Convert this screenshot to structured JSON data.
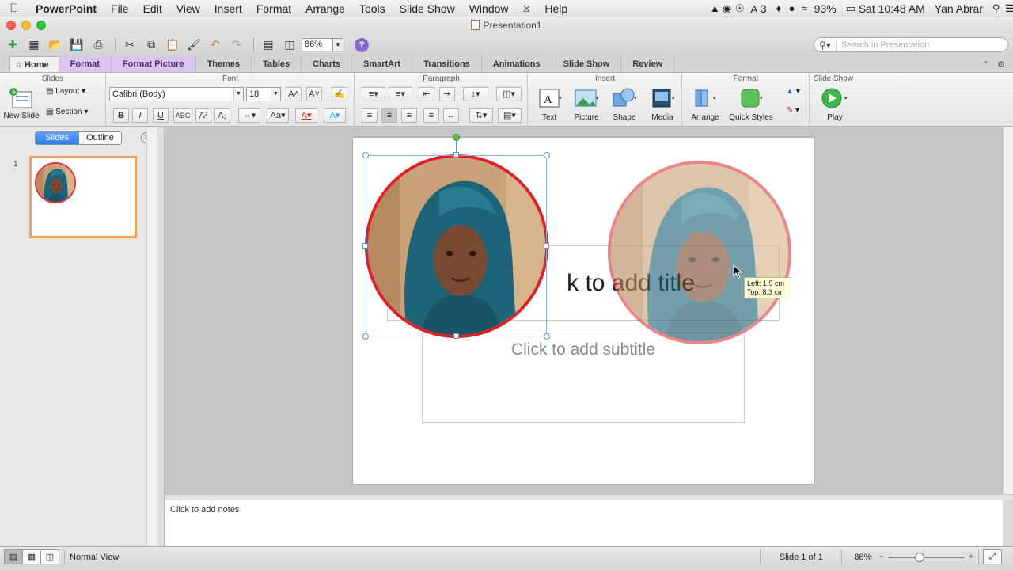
{
  "menubar": {
    "app_name": "PowerPoint",
    "items": [
      "File",
      "Edit",
      "View",
      "Insert",
      "Format",
      "Arrange",
      "Tools",
      "Slide Show",
      "Window",
      "Help"
    ],
    "status": {
      "notif_count": "3",
      "battery": "93%",
      "clock": "Sat 10:48 AM",
      "user": "Yan Abrar"
    }
  },
  "window": {
    "title": "Presentation1"
  },
  "toolbar": {
    "zoom": "86%",
    "search_placeholder": "Search in Presentation"
  },
  "ribbon_tabs": [
    "Home",
    "Format",
    "Format Picture",
    "Themes",
    "Tables",
    "Charts",
    "SmartArt",
    "Transitions",
    "Animations",
    "Slide Show",
    "Review"
  ],
  "ribbon": {
    "groups": {
      "slides": "Slides",
      "font": "Font",
      "paragraph": "Paragraph",
      "insert": "Insert",
      "format": "Format",
      "slideshow": "Slide Show"
    },
    "new_slide": "New Slide",
    "layout": "Layout",
    "section": "Section",
    "font_name": "Calibri (Body)",
    "font_size": "18",
    "insert_buttons": [
      "Text",
      "Picture",
      "Shape",
      "Media"
    ],
    "arrange": "Arrange",
    "quick_styles": "Quick Styles",
    "play": "Play"
  },
  "left_pane": {
    "tab_slides": "Slides",
    "tab_outline": "Outline",
    "slide_number": "1"
  },
  "slide": {
    "title_placeholder": "k to add title",
    "subtitle_placeholder": "Click to add subtitle",
    "tooltip_left": "Left: 1.5 cm",
    "tooltip_top": "Top: 8.3 cm"
  },
  "notes": {
    "placeholder": "Click to add notes"
  },
  "statusbar": {
    "view": "Normal View",
    "slide_count": "Slide 1 of 1",
    "zoom": "86%"
  },
  "colors": {
    "accent_orange": "#f5a04b",
    "picture_border": "#e01f26",
    "ribbon_purple": "#d9c6ee",
    "hijab": "#1e6478"
  }
}
